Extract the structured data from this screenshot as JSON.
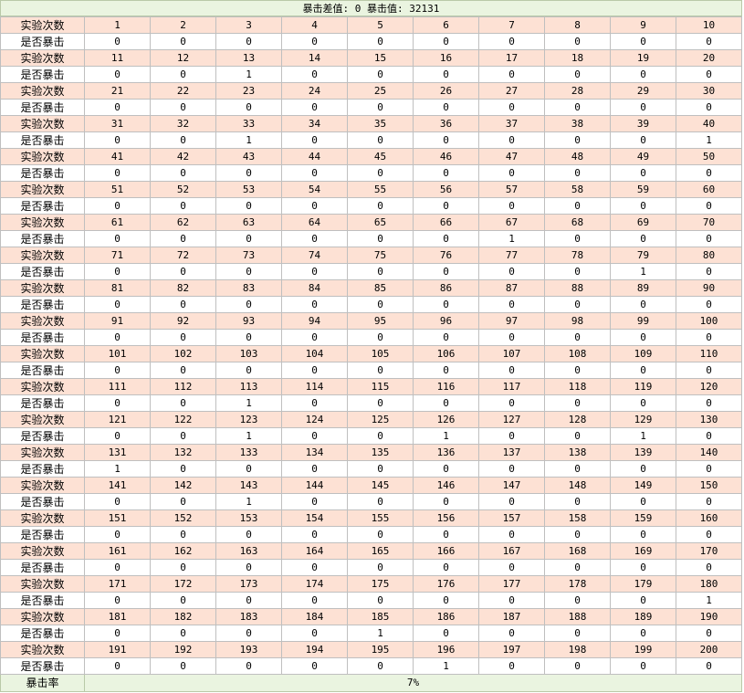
{
  "header": {
    "title": "暴击差值: 0 暴击值: 32131"
  },
  "row_labels": {
    "trial": "实验次数",
    "crit": "是否暴击"
  },
  "blocks": [
    {
      "trials": [
        "1",
        "2",
        "3",
        "4",
        "5",
        "6",
        "7",
        "8",
        "9",
        "10"
      ],
      "crits": [
        "0",
        "0",
        "0",
        "0",
        "0",
        "0",
        "0",
        "0",
        "0",
        "0"
      ]
    },
    {
      "trials": [
        "11",
        "12",
        "13",
        "14",
        "15",
        "16",
        "17",
        "18",
        "19",
        "20"
      ],
      "crits": [
        "0",
        "0",
        "1",
        "0",
        "0",
        "0",
        "0",
        "0",
        "0",
        "0"
      ]
    },
    {
      "trials": [
        "21",
        "22",
        "23",
        "24",
        "25",
        "26",
        "27",
        "28",
        "29",
        "30"
      ],
      "crits": [
        "0",
        "0",
        "0",
        "0",
        "0",
        "0",
        "0",
        "0",
        "0",
        "0"
      ]
    },
    {
      "trials": [
        "31",
        "32",
        "33",
        "34",
        "35",
        "36",
        "37",
        "38",
        "39",
        "40"
      ],
      "crits": [
        "0",
        "0",
        "1",
        "0",
        "0",
        "0",
        "0",
        "0",
        "0",
        "1"
      ]
    },
    {
      "trials": [
        "41",
        "42",
        "43",
        "44",
        "45",
        "46",
        "47",
        "48",
        "49",
        "50"
      ],
      "crits": [
        "0",
        "0",
        "0",
        "0",
        "0",
        "0",
        "0",
        "0",
        "0",
        "0"
      ]
    },
    {
      "trials": [
        "51",
        "52",
        "53",
        "54",
        "55",
        "56",
        "57",
        "58",
        "59",
        "60"
      ],
      "crits": [
        "0",
        "0",
        "0",
        "0",
        "0",
        "0",
        "0",
        "0",
        "0",
        "0"
      ]
    },
    {
      "trials": [
        "61",
        "62",
        "63",
        "64",
        "65",
        "66",
        "67",
        "68",
        "69",
        "70"
      ],
      "crits": [
        "0",
        "0",
        "0",
        "0",
        "0",
        "0",
        "1",
        "0",
        "0",
        "0"
      ]
    },
    {
      "trials": [
        "71",
        "72",
        "73",
        "74",
        "75",
        "76",
        "77",
        "78",
        "79",
        "80"
      ],
      "crits": [
        "0",
        "0",
        "0",
        "0",
        "0",
        "0",
        "0",
        "0",
        "1",
        "0"
      ]
    },
    {
      "trials": [
        "81",
        "82",
        "83",
        "84",
        "85",
        "86",
        "87",
        "88",
        "89",
        "90"
      ],
      "crits": [
        "0",
        "0",
        "0",
        "0",
        "0",
        "0",
        "0",
        "0",
        "0",
        "0"
      ]
    },
    {
      "trials": [
        "91",
        "92",
        "93",
        "94",
        "95",
        "96",
        "97",
        "98",
        "99",
        "100"
      ],
      "crits": [
        "0",
        "0",
        "0",
        "0",
        "0",
        "0",
        "0",
        "0",
        "0",
        "0"
      ]
    },
    {
      "trials": [
        "101",
        "102",
        "103",
        "104",
        "105",
        "106",
        "107",
        "108",
        "109",
        "110"
      ],
      "crits": [
        "0",
        "0",
        "0",
        "0",
        "0",
        "0",
        "0",
        "0",
        "0",
        "0"
      ]
    },
    {
      "trials": [
        "111",
        "112",
        "113",
        "114",
        "115",
        "116",
        "117",
        "118",
        "119",
        "120"
      ],
      "crits": [
        "0",
        "0",
        "1",
        "0",
        "0",
        "0",
        "0",
        "0",
        "0",
        "0"
      ]
    },
    {
      "trials": [
        "121",
        "122",
        "123",
        "124",
        "125",
        "126",
        "127",
        "128",
        "129",
        "130"
      ],
      "crits": [
        "0",
        "0",
        "1",
        "0",
        "0",
        "1",
        "0",
        "0",
        "1",
        "0"
      ]
    },
    {
      "trials": [
        "131",
        "132",
        "133",
        "134",
        "135",
        "136",
        "137",
        "138",
        "139",
        "140"
      ],
      "crits": [
        "1",
        "0",
        "0",
        "0",
        "0",
        "0",
        "0",
        "0",
        "0",
        "0"
      ]
    },
    {
      "trials": [
        "141",
        "142",
        "143",
        "144",
        "145",
        "146",
        "147",
        "148",
        "149",
        "150"
      ],
      "crits": [
        "0",
        "0",
        "1",
        "0",
        "0",
        "0",
        "0",
        "0",
        "0",
        "0"
      ]
    },
    {
      "trials": [
        "151",
        "152",
        "153",
        "154",
        "155",
        "156",
        "157",
        "158",
        "159",
        "160"
      ],
      "crits": [
        "0",
        "0",
        "0",
        "0",
        "0",
        "0",
        "0",
        "0",
        "0",
        "0"
      ]
    },
    {
      "trials": [
        "161",
        "162",
        "163",
        "164",
        "165",
        "166",
        "167",
        "168",
        "169",
        "170"
      ],
      "crits": [
        "0",
        "0",
        "0",
        "0",
        "0",
        "0",
        "0",
        "0",
        "0",
        "0"
      ]
    },
    {
      "trials": [
        "171",
        "172",
        "173",
        "174",
        "175",
        "176",
        "177",
        "178",
        "179",
        "180"
      ],
      "crits": [
        "0",
        "0",
        "0",
        "0",
        "0",
        "0",
        "0",
        "0",
        "0",
        "1"
      ]
    },
    {
      "trials": [
        "181",
        "182",
        "183",
        "184",
        "185",
        "186",
        "187",
        "188",
        "189",
        "190"
      ],
      "crits": [
        "0",
        "0",
        "0",
        "0",
        "1",
        "0",
        "0",
        "0",
        "0",
        "0"
      ]
    },
    {
      "trials": [
        "191",
        "192",
        "193",
        "194",
        "195",
        "196",
        "197",
        "198",
        "199",
        "200"
      ],
      "crits": [
        "0",
        "0",
        "0",
        "0",
        "0",
        "1",
        "0",
        "0",
        "0",
        "0"
      ]
    }
  ],
  "footer": {
    "label": "暴击率",
    "value": "7%"
  },
  "colors": {
    "trial_row_bg": "#fde1d4",
    "crit_row_bg": "#ffffff",
    "header_bg": "#eaf4e0",
    "grid_line": "#bfbfbf"
  }
}
